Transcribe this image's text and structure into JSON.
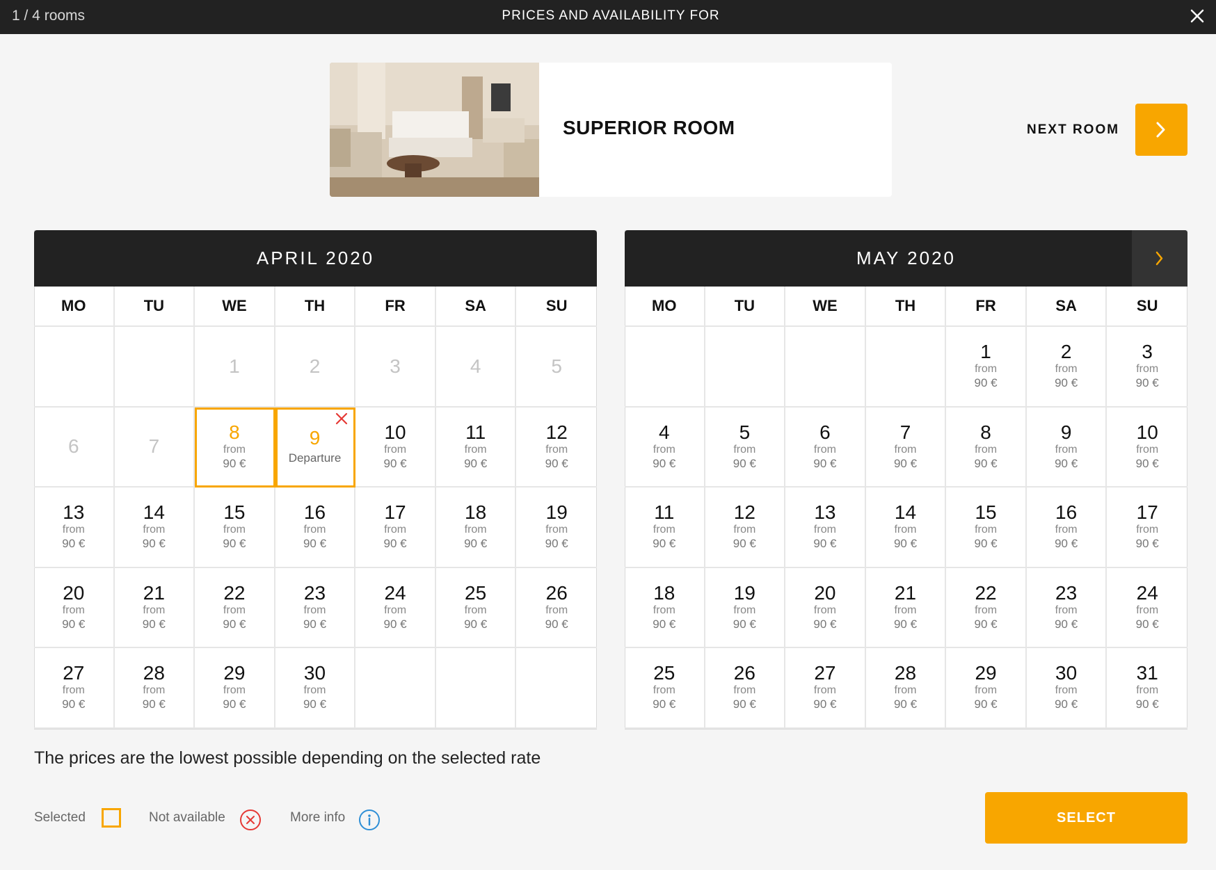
{
  "topbar": {
    "room_counter": "1 / 4 rooms",
    "title": "PRICES AND AVAILABILITY FOR"
  },
  "room": {
    "name": "SUPERIOR ROOM",
    "next_label": "NEXT ROOM"
  },
  "calendar_left": {
    "month": "APRIL 2020",
    "weekdays": [
      "MO",
      "TU",
      "WE",
      "TH",
      "FR",
      "SA",
      "SU"
    ],
    "days": [
      {
        "n": ""
      },
      {
        "n": ""
      },
      {
        "n": "1",
        "state": "past"
      },
      {
        "n": "2",
        "state": "past"
      },
      {
        "n": "3",
        "state": "past"
      },
      {
        "n": "4",
        "state": "past"
      },
      {
        "n": "5",
        "state": "past"
      },
      {
        "n": "6",
        "state": "past"
      },
      {
        "n": "7",
        "state": "past"
      },
      {
        "n": "8",
        "state": "selected",
        "from": "from",
        "price": "90 €"
      },
      {
        "n": "9",
        "state": "departure",
        "label": "Departure"
      },
      {
        "n": "10",
        "from": "from",
        "price": "90 €"
      },
      {
        "n": "11",
        "from": "from",
        "price": "90 €"
      },
      {
        "n": "12",
        "from": "from",
        "price": "90 €"
      },
      {
        "n": "13",
        "from": "from",
        "price": "90 €"
      },
      {
        "n": "14",
        "from": "from",
        "price": "90 €"
      },
      {
        "n": "15",
        "from": "from",
        "price": "90 €"
      },
      {
        "n": "16",
        "from": "from",
        "price": "90 €"
      },
      {
        "n": "17",
        "from": "from",
        "price": "90 €"
      },
      {
        "n": "18",
        "from": "from",
        "price": "90 €"
      },
      {
        "n": "19",
        "from": "from",
        "price": "90 €"
      },
      {
        "n": "20",
        "from": "from",
        "price": "90 €"
      },
      {
        "n": "21",
        "from": "from",
        "price": "90 €"
      },
      {
        "n": "22",
        "from": "from",
        "price": "90 €"
      },
      {
        "n": "23",
        "from": "from",
        "price": "90 €"
      },
      {
        "n": "24",
        "from": "from",
        "price": "90 €"
      },
      {
        "n": "25",
        "from": "from",
        "price": "90 €"
      },
      {
        "n": "26",
        "from": "from",
        "price": "90 €"
      },
      {
        "n": "27",
        "from": "from",
        "price": "90 €"
      },
      {
        "n": "28",
        "from": "from",
        "price": "90 €"
      },
      {
        "n": "29",
        "from": "from",
        "price": "90 €"
      },
      {
        "n": "30",
        "from": "from",
        "price": "90 €"
      },
      {
        "n": ""
      },
      {
        "n": ""
      },
      {
        "n": ""
      }
    ]
  },
  "calendar_right": {
    "month": "MAY 2020",
    "weekdays": [
      "MO",
      "TU",
      "WE",
      "TH",
      "FR",
      "SA",
      "SU"
    ],
    "days": [
      {
        "n": ""
      },
      {
        "n": ""
      },
      {
        "n": ""
      },
      {
        "n": ""
      },
      {
        "n": "1",
        "from": "from",
        "price": "90 €"
      },
      {
        "n": "2",
        "from": "from",
        "price": "90 €"
      },
      {
        "n": "3",
        "from": "from",
        "price": "90 €"
      },
      {
        "n": "4",
        "from": "from",
        "price": "90 €"
      },
      {
        "n": "5",
        "from": "from",
        "price": "90 €"
      },
      {
        "n": "6",
        "from": "from",
        "price": "90 €"
      },
      {
        "n": "7",
        "from": "from",
        "price": "90 €"
      },
      {
        "n": "8",
        "from": "from",
        "price": "90 €"
      },
      {
        "n": "9",
        "from": "from",
        "price": "90 €"
      },
      {
        "n": "10",
        "from": "from",
        "price": "90 €"
      },
      {
        "n": "11",
        "from": "from",
        "price": "90 €"
      },
      {
        "n": "12",
        "from": "from",
        "price": "90 €"
      },
      {
        "n": "13",
        "from": "from",
        "price": "90 €"
      },
      {
        "n": "14",
        "from": "from",
        "price": "90 €"
      },
      {
        "n": "15",
        "from": "from",
        "price": "90 €"
      },
      {
        "n": "16",
        "from": "from",
        "price": "90 €"
      },
      {
        "n": "17",
        "from": "from",
        "price": "90 €"
      },
      {
        "n": "18",
        "from": "from",
        "price": "90 €"
      },
      {
        "n": "19",
        "from": "from",
        "price": "90 €"
      },
      {
        "n": "20",
        "from": "from",
        "price": "90 €"
      },
      {
        "n": "21",
        "from": "from",
        "price": "90 €"
      },
      {
        "n": "22",
        "from": "from",
        "price": "90 €"
      },
      {
        "n": "23",
        "from": "from",
        "price": "90 €"
      },
      {
        "n": "24",
        "from": "from",
        "price": "90 €"
      },
      {
        "n": "25",
        "from": "from",
        "price": "90 €"
      },
      {
        "n": "26",
        "from": "from",
        "price": "90 €"
      },
      {
        "n": "27",
        "from": "from",
        "price": "90 €"
      },
      {
        "n": "28",
        "from": "from",
        "price": "90 €"
      },
      {
        "n": "29",
        "from": "from",
        "price": "90 €"
      },
      {
        "n": "30",
        "from": "from",
        "price": "90 €"
      },
      {
        "n": "31",
        "from": "from",
        "price": "90 €"
      }
    ]
  },
  "footer": {
    "note": "The prices are the lowest possible depending on the selected rate",
    "legend_selected": "Selected",
    "legend_not_available": "Not available",
    "legend_more_info": "More info",
    "select_label": "SELECT"
  },
  "icons": {
    "close": "close-icon",
    "next_room": "chevron-right-icon",
    "next_month": "chevron-right-icon",
    "not_available": "circle-x-icon",
    "more_info": "info-icon"
  },
  "colors": {
    "accent": "#f8a600",
    "header_bg": "#222222",
    "unavailable": "#e53935",
    "info": "#2f8fd6"
  }
}
